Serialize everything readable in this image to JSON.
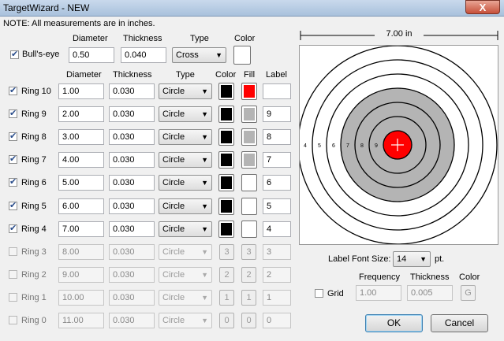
{
  "window": {
    "title": "TargetWizard - NEW",
    "close_glyph": "X"
  },
  "note": "NOTE: All measurements are in inches.",
  "dimension_label": "7.00 in",
  "bullseye": {
    "headers": {
      "diameter": "Diameter",
      "thickness": "Thickness",
      "type": "Type",
      "color": "Color"
    },
    "label": "Bull's-eye",
    "checked": true,
    "diameter": "0.50",
    "thickness": "0.040",
    "type": "Cross",
    "color": "#ffffff"
  },
  "rings_headers": {
    "diameter": "Diameter",
    "thickness": "Thickness",
    "type": "Type",
    "color": "Color",
    "fill": "Fill",
    "label": "Label"
  },
  "rings": [
    {
      "name": "Ring 10",
      "checked": true,
      "diameter": "1.00",
      "thickness": "0.030",
      "type": "Circle",
      "color": "#000000",
      "fill": "#ff0000",
      "label": "",
      "enabled": true
    },
    {
      "name": "Ring 9",
      "checked": true,
      "diameter": "2.00",
      "thickness": "0.030",
      "type": "Circle",
      "color": "#000000",
      "fill": "#b4b4b4",
      "label": "9",
      "enabled": true
    },
    {
      "name": "Ring 8",
      "checked": true,
      "diameter": "3.00",
      "thickness": "0.030",
      "type": "Circle",
      "color": "#000000",
      "fill": "#b4b4b4",
      "label": "8",
      "enabled": true
    },
    {
      "name": "Ring 7",
      "checked": true,
      "diameter": "4.00",
      "thickness": "0.030",
      "type": "Circle",
      "color": "#000000",
      "fill": "#b4b4b4",
      "label": "7",
      "enabled": true
    },
    {
      "name": "Ring 6",
      "checked": true,
      "diameter": "5.00",
      "thickness": "0.030",
      "type": "Circle",
      "color": "#000000",
      "fill": "#ffffff",
      "label": "6",
      "enabled": true
    },
    {
      "name": "Ring 5",
      "checked": true,
      "diameter": "6.00",
      "thickness": "0.030",
      "type": "Circle",
      "color": "#000000",
      "fill": "#ffffff",
      "label": "5",
      "enabled": true
    },
    {
      "name": "Ring 4",
      "checked": true,
      "diameter": "7.00",
      "thickness": "0.030",
      "type": "Circle",
      "color": "#000000",
      "fill": "#ffffff",
      "label": "4",
      "enabled": true
    },
    {
      "name": "Ring 3",
      "checked": false,
      "diameter": "8.00",
      "thickness": "0.030",
      "type": "Circle",
      "color_btn": "3",
      "fill_btn": "3",
      "label": "3",
      "enabled": false
    },
    {
      "name": "Ring 2",
      "checked": false,
      "diameter": "9.00",
      "thickness": "0.030",
      "type": "Circle",
      "color_btn": "2",
      "fill_btn": "2",
      "label": "2",
      "enabled": false
    },
    {
      "name": "Ring 1",
      "checked": false,
      "diameter": "10.00",
      "thickness": "0.030",
      "type": "Circle",
      "color_btn": "1",
      "fill_btn": "1",
      "label": "1",
      "enabled": false
    },
    {
      "name": "Ring 0",
      "checked": false,
      "diameter": "11.00",
      "thickness": "0.030",
      "type": "Circle",
      "color_btn": "0",
      "fill_btn": "0",
      "label": "0",
      "enabled": false
    }
  ],
  "preview": {
    "labels": [
      "4",
      "5",
      "6",
      "7",
      "8",
      "9"
    ],
    "gray_fill": "#b4b4b4",
    "bull_fill": "#ff0000"
  },
  "label_font": {
    "label": "Label Font Size:",
    "value": "14",
    "unit": "pt."
  },
  "grid": {
    "label": "Grid",
    "checked": false,
    "headers": {
      "frequency": "Frequency",
      "thickness": "Thickness",
      "color": "Color"
    },
    "frequency": "1.00",
    "thickness": "0.005",
    "color_btn": "G"
  },
  "buttons": {
    "ok": "OK",
    "cancel": "Cancel"
  }
}
